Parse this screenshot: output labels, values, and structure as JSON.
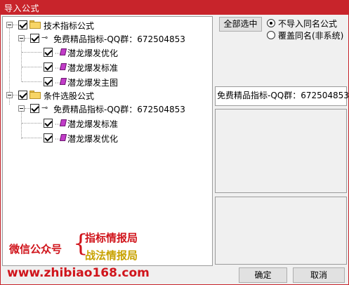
{
  "window": {
    "title": "导入公式"
  },
  "tree": {
    "groups": [
      {
        "label": "技术指标公式",
        "checked": true,
        "child": {
          "label": "免费精品指标-QQ群：672504853",
          "checked": true,
          "items": [
            {
              "label": "潜龙爆发优化",
              "checked": true
            },
            {
              "label": "潜龙爆发标准",
              "checked": true
            },
            {
              "label": "潜龙爆发主图",
              "checked": true
            }
          ]
        }
      },
      {
        "label": "条件选股公式",
        "checked": true,
        "child": {
          "label": "免费精品指标-QQ群：672504853",
          "checked": true,
          "items": [
            {
              "label": "潜龙爆发标准",
              "checked": true
            },
            {
              "label": "潜龙爆发优化",
              "checked": true
            }
          ]
        }
      }
    ]
  },
  "controls": {
    "select_all_label": "全部选中",
    "radio_no_import": "不导入同名公式",
    "radio_overwrite": "覆盖同名(非系统)",
    "selected_radio": "no_import"
  },
  "info": {
    "name_text": "免费精品指标-QQ群：672504853"
  },
  "promo": {
    "wechat_label": "微信公众号",
    "brace": "{",
    "line1": "指标情报局",
    "line2": "战法情报局",
    "url": "www.zhibiao168.com"
  },
  "buttons": {
    "ok_label": "确定",
    "cancel_label": "取消"
  },
  "colors": {
    "titlebar": "#c8242b",
    "promo_red": "#d0141b",
    "promo_gold": "#c8a200",
    "gem": "#c23cc8"
  },
  "icons": {
    "folder": "folder-icon",
    "key": "key-icon",
    "formula": "formula-icon"
  }
}
